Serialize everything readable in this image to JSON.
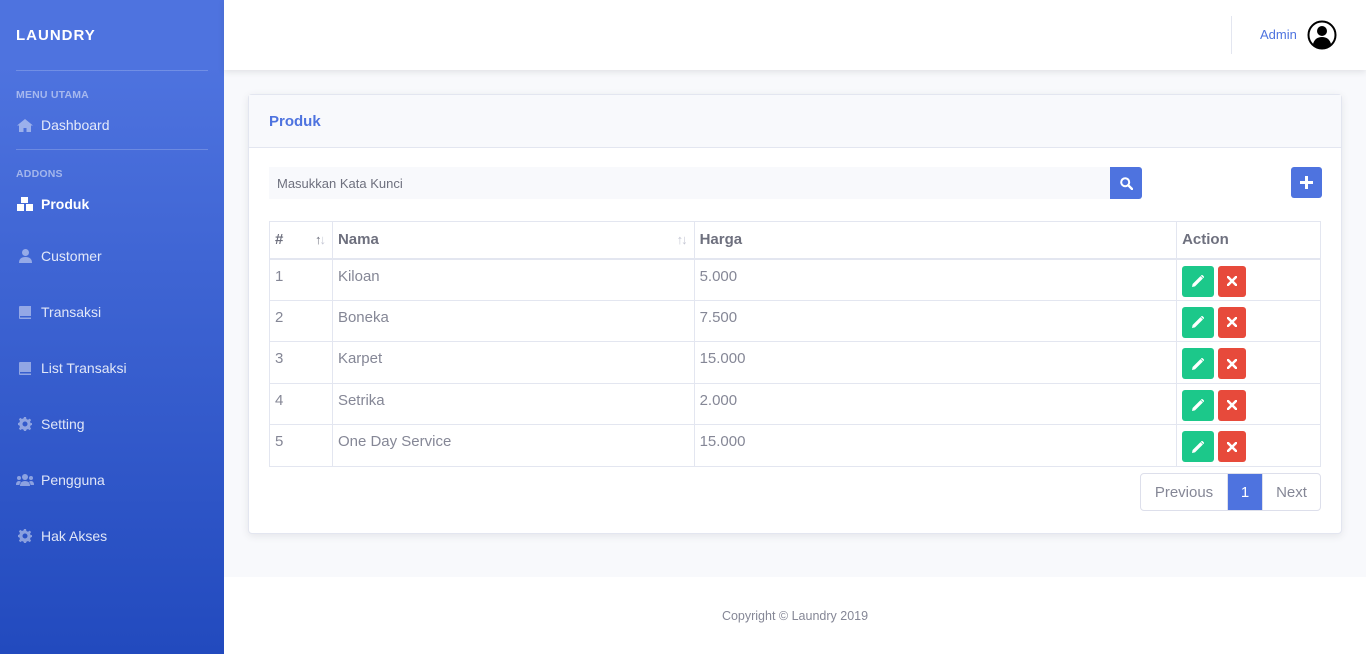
{
  "brand": "LAUNDRY",
  "sidebar": {
    "heading_main": "MENU UTAMA",
    "heading_addons": "ADDONS",
    "items": [
      {
        "label": "Dashboard",
        "icon": "home-icon"
      },
      {
        "label": "Produk",
        "icon": "boxes-icon",
        "active": true
      },
      {
        "label": "Customer",
        "icon": "user-icon"
      },
      {
        "label": "Transaksi",
        "icon": "book-icon"
      },
      {
        "label": "List Transaksi",
        "icon": "book-icon"
      },
      {
        "label": "Setting",
        "icon": "gear-icon"
      },
      {
        "label": "Pengguna",
        "icon": "users-icon"
      },
      {
        "label": "Hak Akses",
        "icon": "gear-icon"
      }
    ]
  },
  "topbar": {
    "user_name": "Admin",
    "avatar_icon": "user-circle-icon"
  },
  "card": {
    "title": "Produk",
    "search_placeholder": "Masukkan Kata Kunci",
    "table": {
      "headers": [
        "#",
        "Nama",
        "Harga",
        "Action"
      ],
      "rows": [
        [
          "1",
          "Kiloan",
          "5.000"
        ],
        [
          "2",
          "Boneka",
          "7.500"
        ],
        [
          "3",
          "Karpet",
          "15.000"
        ],
        [
          "4",
          "Setrika",
          "2.000"
        ],
        [
          "5",
          "One Day Service",
          "15.000"
        ]
      ]
    },
    "pagination": {
      "previous": "Previous",
      "current": "1",
      "next": "Next"
    }
  },
  "footer": "Copyright © Laundry 2019",
  "colors": {
    "primary": "#4e73df",
    "success": "#1cc88a",
    "danger": "#e74a3b"
  }
}
